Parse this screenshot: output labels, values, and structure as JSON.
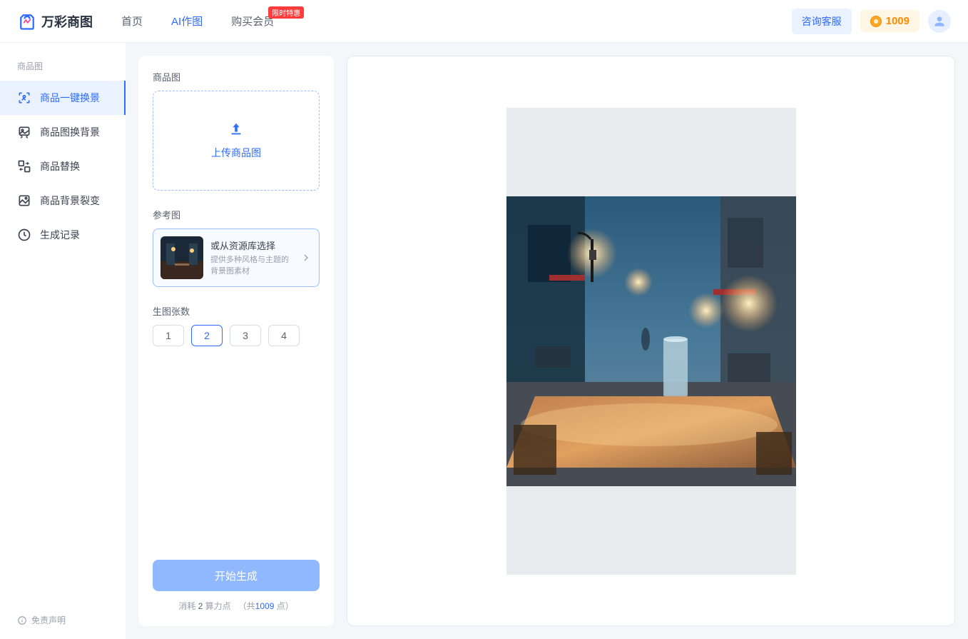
{
  "header": {
    "logo_text": "万彩商图",
    "nav": [
      {
        "label": "首页",
        "active": false
      },
      {
        "label": "AI作图",
        "active": true
      },
      {
        "label": "购买会员",
        "active": false,
        "badge": "限时特惠"
      }
    ],
    "cs_button": "咨询客服",
    "credits": "1009"
  },
  "sidebar": {
    "section_label": "商品图",
    "items": [
      {
        "label": "商品一键换景",
        "icon": "frame-scan-icon",
        "active": true
      },
      {
        "label": "商品图换背景",
        "icon": "picture-swap-icon",
        "active": false
      },
      {
        "label": "商品替换",
        "icon": "replace-icon",
        "active": false
      },
      {
        "label": "商品背景裂变",
        "icon": "split-icon",
        "active": false
      },
      {
        "label": "生成记录",
        "icon": "history-icon",
        "active": false
      }
    ],
    "footer": "免责声明"
  },
  "panel": {
    "upload_label": "商品图",
    "upload_text": "上传商品图",
    "ref_label": "参考图",
    "ref_title": "或从资源库选择",
    "ref_desc": "提供多种风格与主题的背景图素材",
    "count_label": "生图张数",
    "count_options": [
      "1",
      "2",
      "3",
      "4"
    ],
    "count_selected": "2",
    "generate": "开始生成",
    "cost_prefix": "消耗 ",
    "cost_num": "2",
    "cost_unit": " 算力点",
    "cost_total_prefix": "（共",
    "cost_total": "1009",
    "cost_total_suffix": " 点）"
  },
  "colors": {
    "primary": "#2e6bff",
    "accent_orange": "#ff8a00",
    "badge_red": "#ff3b3b"
  }
}
